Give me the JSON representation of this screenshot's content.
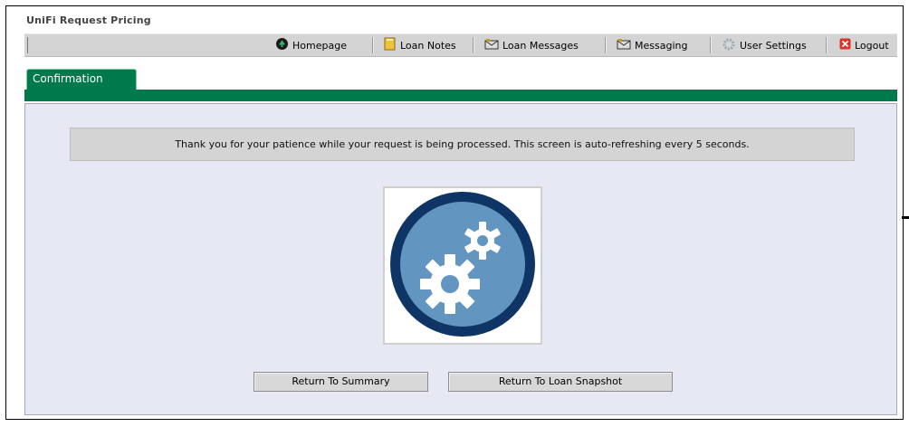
{
  "app": {
    "title": "UniFi Request Pricing"
  },
  "toolbar": {
    "items": [
      {
        "label": "Homepage",
        "icon": "home-icon"
      },
      {
        "label": "Loan Notes",
        "icon": "notes-icon"
      },
      {
        "label": "Loan Messages",
        "icon": "loan-messages-icon"
      },
      {
        "label": "Messaging",
        "icon": "messaging-icon"
      },
      {
        "label": "User Settings",
        "icon": "gear-icon"
      },
      {
        "label": "Logout",
        "icon": "logout-icon"
      }
    ]
  },
  "tabs": [
    {
      "label": "Confirmation",
      "active": true
    }
  ],
  "main": {
    "message": "Thank you for your patience while your request is being processed. This screen is auto-refreshing every 5 seconds.",
    "image_icon": "processing-gears-icon"
  },
  "buttons": {
    "return_summary": "Return To Summary",
    "return_snapshot": "Return To Loan Snapshot"
  },
  "colors": {
    "accent_green": "#007a4a",
    "content_bg": "#e6e8f3",
    "gear_circle": "#6395c1",
    "gear_ring": "#0e3566"
  }
}
